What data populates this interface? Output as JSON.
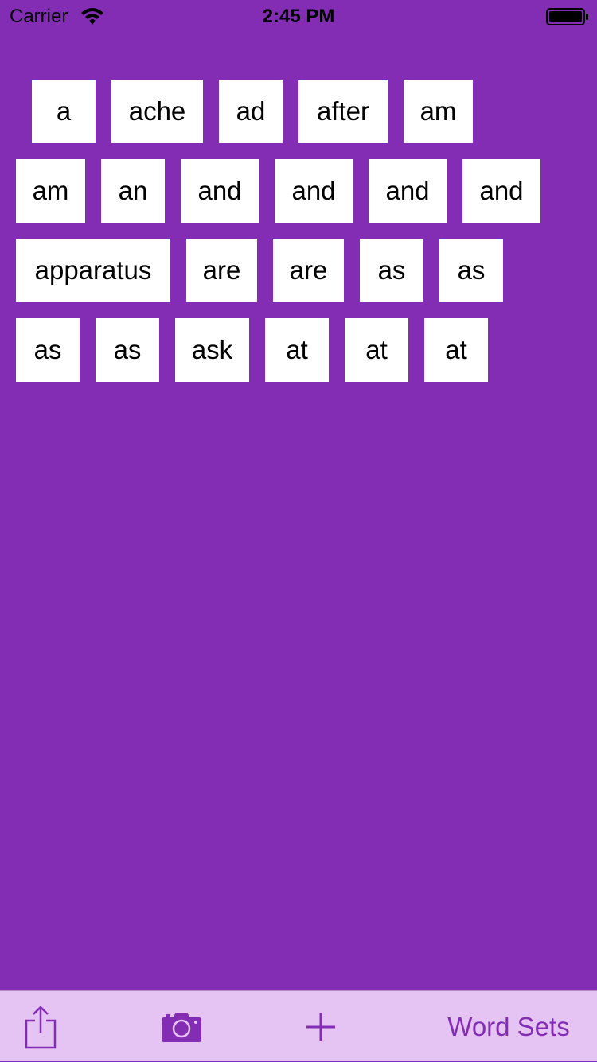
{
  "status_bar": {
    "carrier": "Carrier",
    "time": "2:45 PM",
    "wifi_icon": "wifi-icon",
    "battery_icon": "battery-icon"
  },
  "colors": {
    "background": "#832db5",
    "tile": "#ffffff",
    "tab_bar": "#e5c4f3",
    "accent": "#832db5"
  },
  "word_rows": [
    [
      "a",
      "ache",
      "ad",
      "after",
      "am"
    ],
    [
      "am",
      "an",
      "and",
      "and",
      "and",
      "and"
    ],
    [
      "apparatus",
      "are",
      "are",
      "as",
      "as"
    ],
    [
      "as",
      "as",
      "ask",
      "at",
      "at",
      "at"
    ]
  ],
  "toolbar": {
    "share_icon": "share-icon",
    "camera_icon": "camera-icon",
    "add_icon": "plus-icon",
    "word_sets_label": "Word Sets"
  }
}
